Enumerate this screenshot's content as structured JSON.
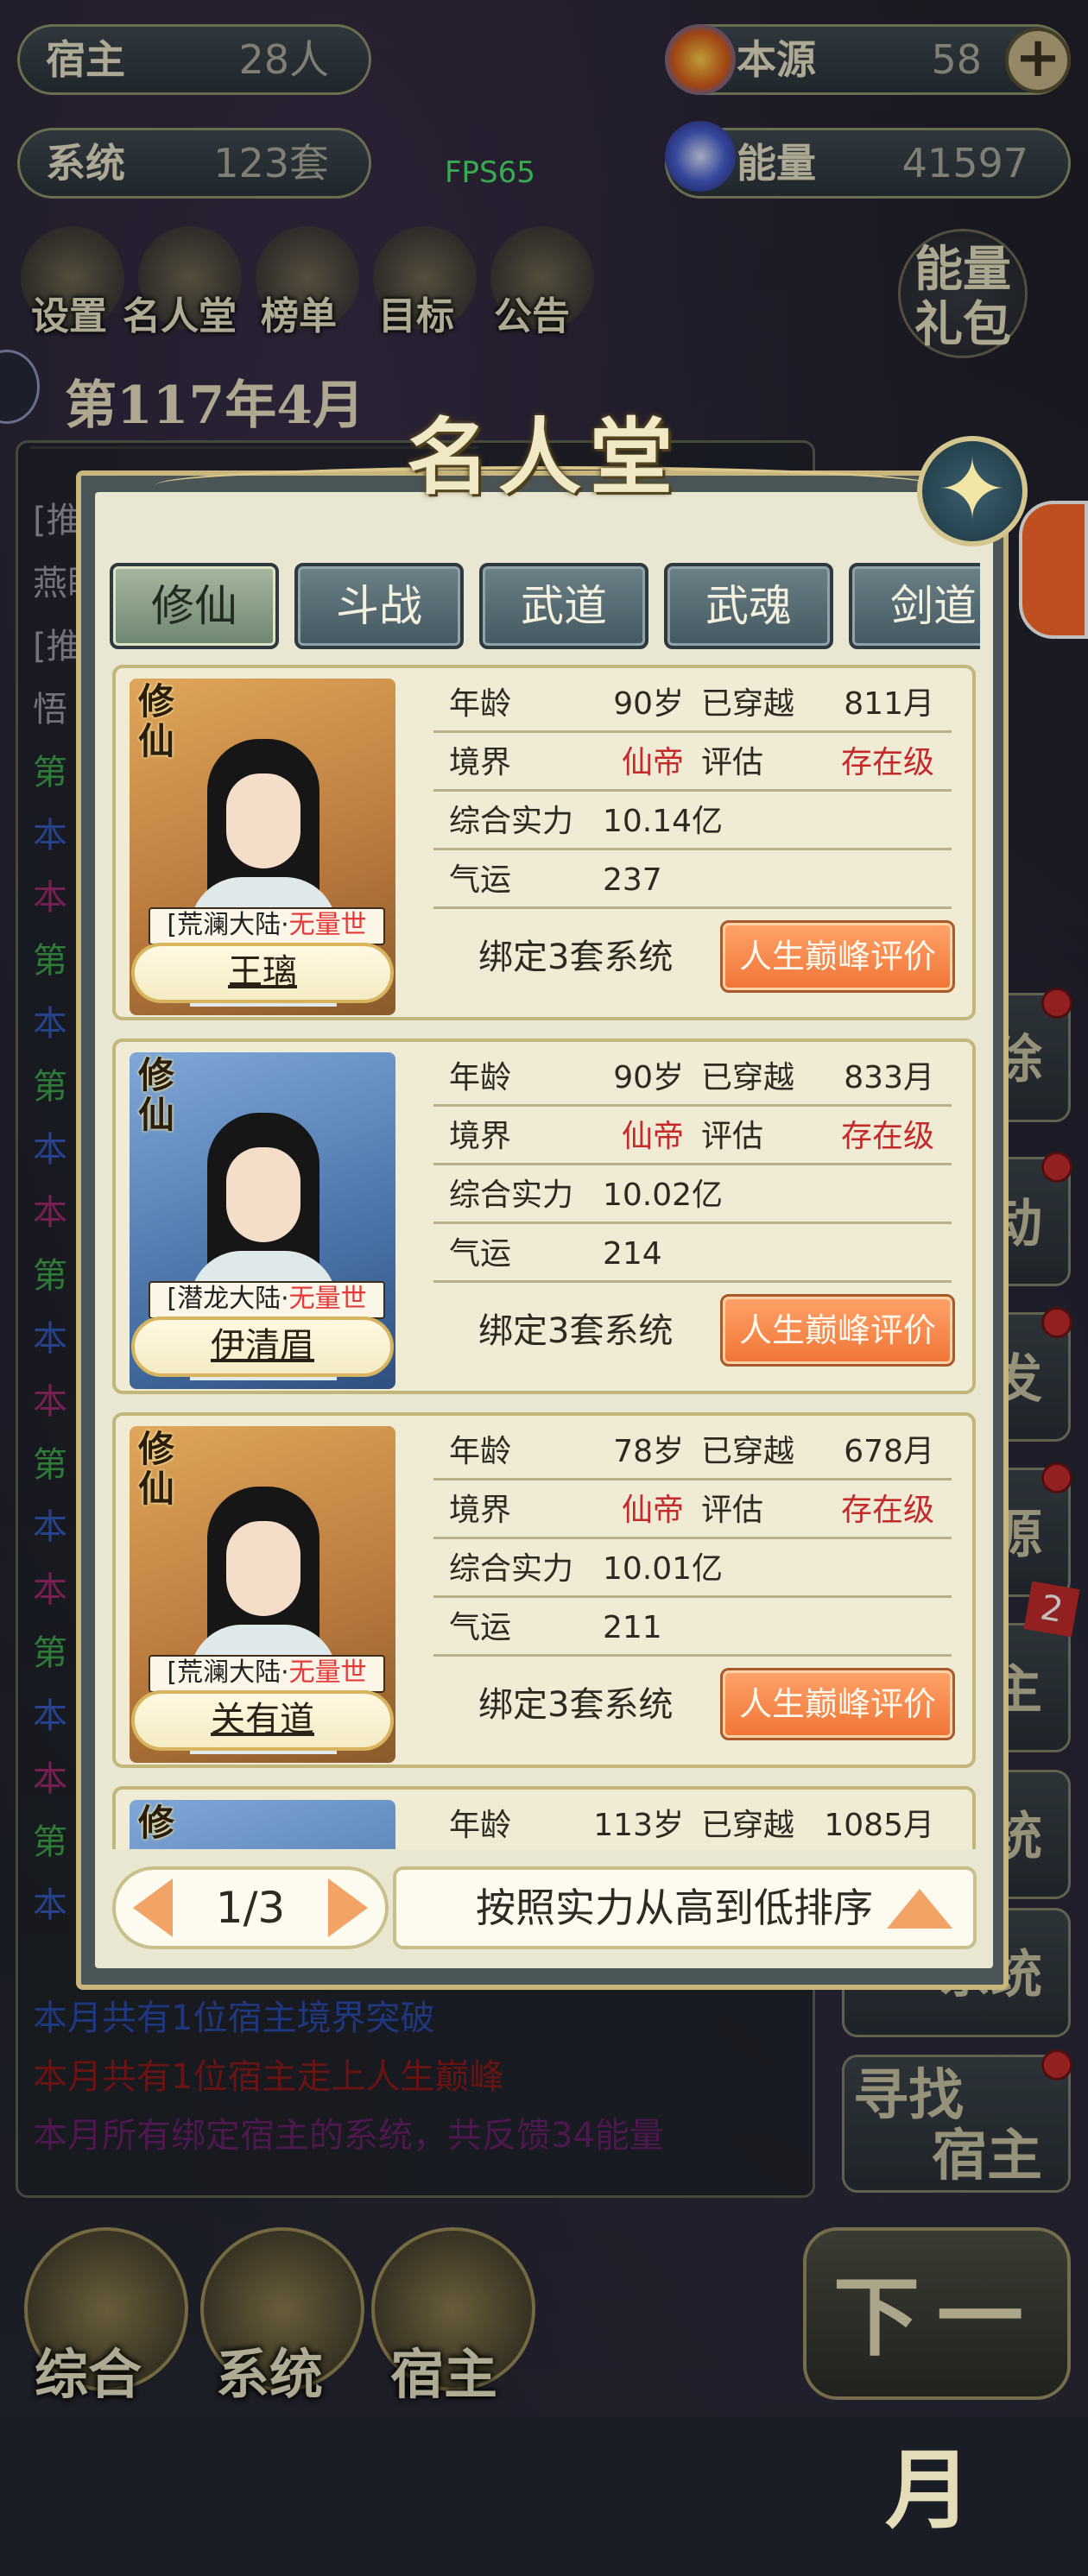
{
  "top_stats": {
    "hosts": {
      "label": "宿主",
      "value": "28人"
    },
    "systems": {
      "label": "系统",
      "value": "123套"
    },
    "source": {
      "label": "本源",
      "value": "58"
    },
    "energy": {
      "label": "能量",
      "value": "41597"
    }
  },
  "fps": "FPS65",
  "top_nav": [
    "设置",
    "名人堂",
    "榜单",
    "目标",
    "公告"
  ],
  "energy_gift": {
    "line1": "能量",
    "line2": "礼包"
  },
  "date": "第117年4月",
  "log_lines": [
    {
      "text": "[推",
      "color": "#9a9aa8"
    },
    {
      "text": "燕眀",
      "color": "#9a9aa8"
    },
    {
      "text": "[推",
      "color": "#9a9aa8"
    },
    {
      "text": "悟",
      "color": "#9a9aa8"
    },
    {
      "text": "第",
      "color": "#3fa34a"
    },
    {
      "text": "本",
      "color": "#3558b8"
    },
    {
      "text": "本",
      "color": "#a02a6e"
    },
    {
      "text": "第",
      "color": "#3fa34a"
    },
    {
      "text": "本",
      "color": "#3558b8"
    },
    {
      "text": "第",
      "color": "#3fa34a"
    },
    {
      "text": "本",
      "color": "#3558b8"
    },
    {
      "text": "本",
      "color": "#a02a6e"
    },
    {
      "text": "第",
      "color": "#3fa34a"
    },
    {
      "text": "本",
      "color": "#3558b8"
    },
    {
      "text": "本",
      "color": "#a02a6e"
    },
    {
      "text": "第",
      "color": "#3fa34a"
    },
    {
      "text": "本",
      "color": "#3558b8"
    },
    {
      "text": "本",
      "color": "#a02a6e"
    },
    {
      "text": "第",
      "color": "#3fa34a"
    },
    {
      "text": "本",
      "color": "#3558b8"
    },
    {
      "text": "本",
      "color": "#a02a6e"
    },
    {
      "text": "第",
      "color": "#3fa34a"
    },
    {
      "text": "本",
      "color": "#3558b8"
    }
  ],
  "log_bottom": [
    {
      "text": "本月共有1位宿主境界突破",
      "color": "#2a4aa8"
    },
    {
      "text": "本月共有1位宿主走上人生巅峰",
      "color": "#8e1a1a"
    },
    {
      "text": "本月所有绑定宿主的系统，共反馈34能量",
      "color": "#6a1f6a"
    }
  ],
  "right_buttons": [
    "除",
    "动",
    "发",
    "源",
    "主",
    "统",
    "系统"
  ],
  "right_badge": "2",
  "find_host": {
    "line1": "寻找",
    "line2": "宿主"
  },
  "bottom_nav": [
    "综合",
    "系统",
    "宿主"
  ],
  "next_month": "下一月",
  "modal": {
    "title": "名人堂",
    "tabs": [
      "修仙",
      "斗战",
      "武道",
      "武魂",
      "剑道"
    ],
    "labels": {
      "age": "年龄",
      "traveled": "已穿越",
      "realm": "境界",
      "rating": "评估",
      "power": "综合实力",
      "luck": "气运"
    },
    "cards": [
      {
        "tag": "修仙",
        "world_a": "[荒澜大陆·",
        "world_b": "无量世界]",
        "name": "王璃",
        "style": "gold",
        "age": "90岁",
        "traveled": "811月",
        "realm": "仙帝",
        "rating": "存在级",
        "power": "10.14亿",
        "luck": "237",
        "bind": "绑定3套系统",
        "button": "人生巅峰评价"
      },
      {
        "tag": "修仙",
        "world_a": "[潜龙大陆·",
        "world_b": "无量世界]",
        "name": "伊清眉",
        "style": "blue",
        "age": "90岁",
        "traveled": "833月",
        "realm": "仙帝",
        "rating": "存在级",
        "power": "10.02亿",
        "luck": "214",
        "bind": "绑定3套系统",
        "button": "人生巅峰评价"
      },
      {
        "tag": "修仙",
        "world_a": "[荒澜大陆·",
        "world_b": "无量世界]",
        "name": "关有道",
        "style": "gold",
        "age": "78岁",
        "traveled": "678月",
        "realm": "仙帝",
        "rating": "存在级",
        "power": "10.01亿",
        "luck": "211",
        "bind": "绑定3套系统",
        "button": "人生巅峰评价"
      },
      {
        "tag": "修",
        "world_a": "",
        "world_b": "",
        "name": "",
        "style": "blue",
        "age": "113岁",
        "traveled": "1085月",
        "realm": "",
        "rating": "",
        "power": "",
        "luck": "",
        "bind": "",
        "button": ""
      }
    ],
    "pager": "1/3",
    "sort_label": "按照实力从高到低排序"
  }
}
